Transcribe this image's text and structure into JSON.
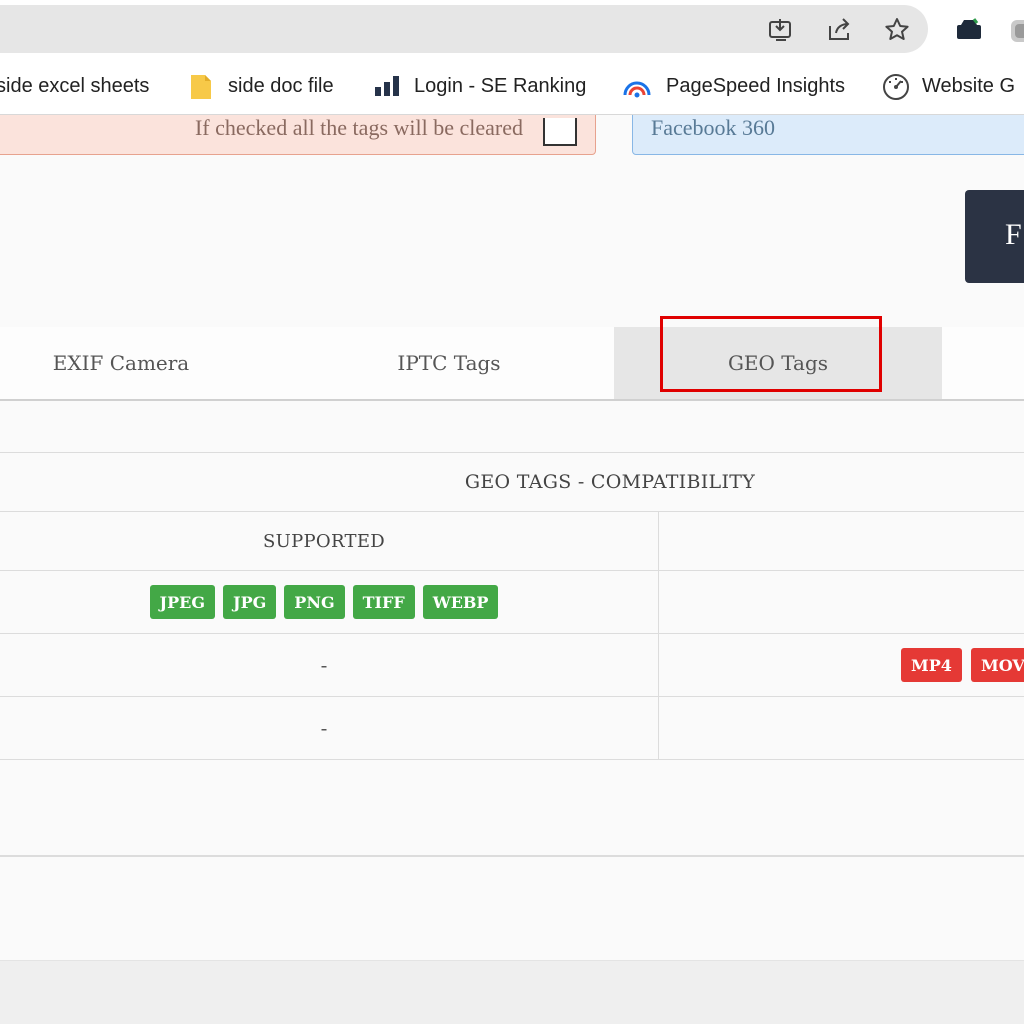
{
  "browser": {
    "toolbar_icons": [
      "install-app-icon",
      "share-icon",
      "bookmark-star-icon",
      "extension-icon",
      "profile-icon"
    ],
    "bookmarks": [
      {
        "label": "side excel sheets",
        "icon": ""
      },
      {
        "label": "side doc file",
        "icon": "folder-icon"
      },
      {
        "label": "Login - SE Ranking",
        "icon": "bar-chart-icon"
      },
      {
        "label": "PageSpeed Insights",
        "icon": "pagespeed-icon"
      },
      {
        "label": "Website G",
        "icon": "gauge-icon"
      }
    ]
  },
  "page": {
    "clear_alert_text": "If checked all the tags will be cleared",
    "info_alert_text": "Facebook 360",
    "action_button_label": "F",
    "tabs": [
      {
        "label": "EXIF Camera",
        "active": false
      },
      {
        "label": "IPTC Tags",
        "active": false
      },
      {
        "label": "GEO Tags",
        "active": true
      }
    ],
    "compatibility": {
      "title": "GEO TAGS - COMPATIBILITY",
      "supported_header": "SUPPORTED",
      "rows": [
        {
          "supported": [
            "JPEG",
            "JPG",
            "PNG",
            "TIFF",
            "WEBP"
          ],
          "unsupported": []
        },
        {
          "supported_text": "-",
          "unsupported": [
            "MP4",
            "MOV"
          ]
        },
        {
          "supported_text": "-",
          "unsupported": []
        }
      ]
    }
  },
  "colors": {
    "supported_badge": "#43a846",
    "unsupported_badge": "#e53935",
    "highlight": "#e00000"
  }
}
